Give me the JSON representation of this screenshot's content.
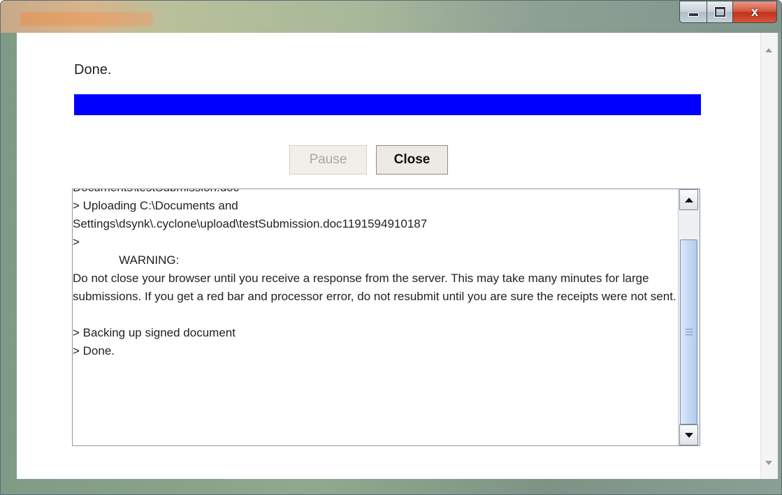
{
  "window": {
    "controls": {
      "minimize_icon": "minimize-icon",
      "maximize_icon": "maximize-icon",
      "close_glyph": "x"
    }
  },
  "status": {
    "label": "Done."
  },
  "progress": {
    "percent": 100,
    "color": "#0000ff"
  },
  "buttons": {
    "pause": "Pause",
    "close": "Close"
  },
  "log": {
    "lines": [
      "Documents\\testSubmission.doc",
      "> Uploading C:\\Documents and",
      "Settings\\dsynk\\.cyclone\\upload\\testSubmission.doc1191594910187",
      ">",
      "              WARNING:",
      "Do not close your browser until you receive a response from the server.  This may take many minutes for large submissions.  If you get a red bar and processor error, do not resubmit until you are sure the receipts were not sent.",
      "",
      "> Backing up signed document",
      "> Done."
    ]
  }
}
